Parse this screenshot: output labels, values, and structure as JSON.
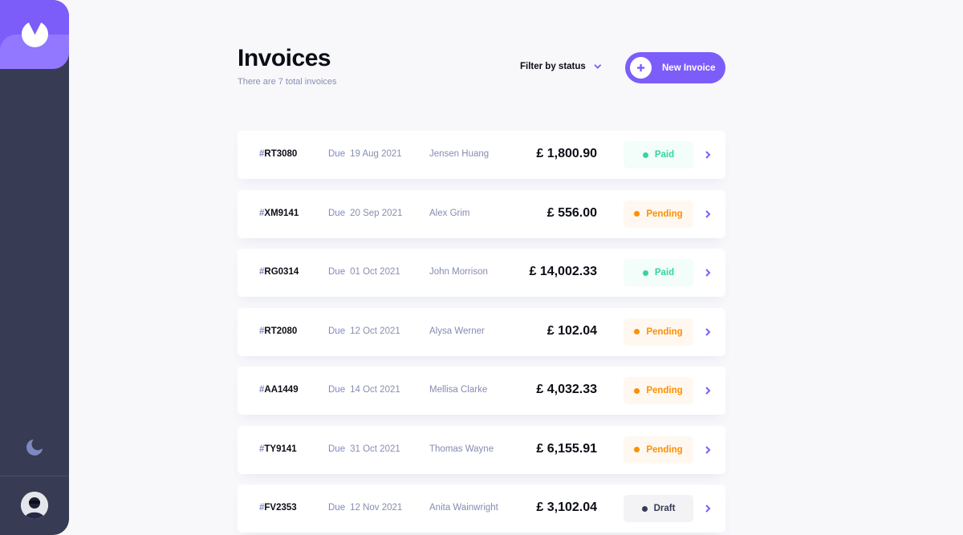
{
  "header": {
    "title": "Invoices",
    "subtitle": "There are 7 total invoices",
    "filter_label": "Filter by status",
    "new_invoice_label": "New Invoice"
  },
  "sidebar": {
    "logo": "logo-icon",
    "theme_toggle": "moon-icon",
    "avatar": "user-avatar"
  },
  "colors": {
    "accent": "#7C5DFA",
    "sidebar": "#373B53",
    "paid": "#33D69F",
    "pending": "#FF8F00",
    "draft": "#373B53"
  },
  "invoices": [
    {
      "hash": "#",
      "id": "RT3080",
      "due_label": "Due",
      "due_date": "19 Aug 2021",
      "client": "Jensen Huang",
      "amount": "£ 1,800.90",
      "status": "Paid",
      "status_type": "paid"
    },
    {
      "hash": "#",
      "id": "XM9141",
      "due_label": "Due",
      "due_date": "20 Sep 2021",
      "client": "Alex Grim",
      "amount": "£ 556.00",
      "status": "Pending",
      "status_type": "pending"
    },
    {
      "hash": "#",
      "id": "RG0314",
      "due_label": "Due",
      "due_date": "01 Oct 2021",
      "client": "John Morrison",
      "amount": "£ 14,002.33",
      "status": "Paid",
      "status_type": "paid"
    },
    {
      "hash": "#",
      "id": "RT2080",
      "due_label": "Due",
      "due_date": "12 Oct 2021",
      "client": "Alysa Werner",
      "amount": "£ 102.04",
      "status": "Pending",
      "status_type": "pending"
    },
    {
      "hash": "#",
      "id": "AA1449",
      "due_label": "Due",
      "due_date": "14 Oct 2021",
      "client": "Mellisa Clarke",
      "amount": "£ 4,032.33",
      "status": "Pending",
      "status_type": "pending"
    },
    {
      "hash": "#",
      "id": "TY9141",
      "due_label": "Due",
      "due_date": "31 Oct 2021",
      "client": "Thomas Wayne",
      "amount": "£ 6,155.91",
      "status": "Pending",
      "status_type": "pending"
    },
    {
      "hash": "#",
      "id": "FV2353",
      "due_label": "Due",
      "due_date": "12 Nov 2021",
      "client": "Anita Wainwright",
      "amount": "£ 3,102.04",
      "status": "Draft",
      "status_type": "draft"
    }
  ]
}
